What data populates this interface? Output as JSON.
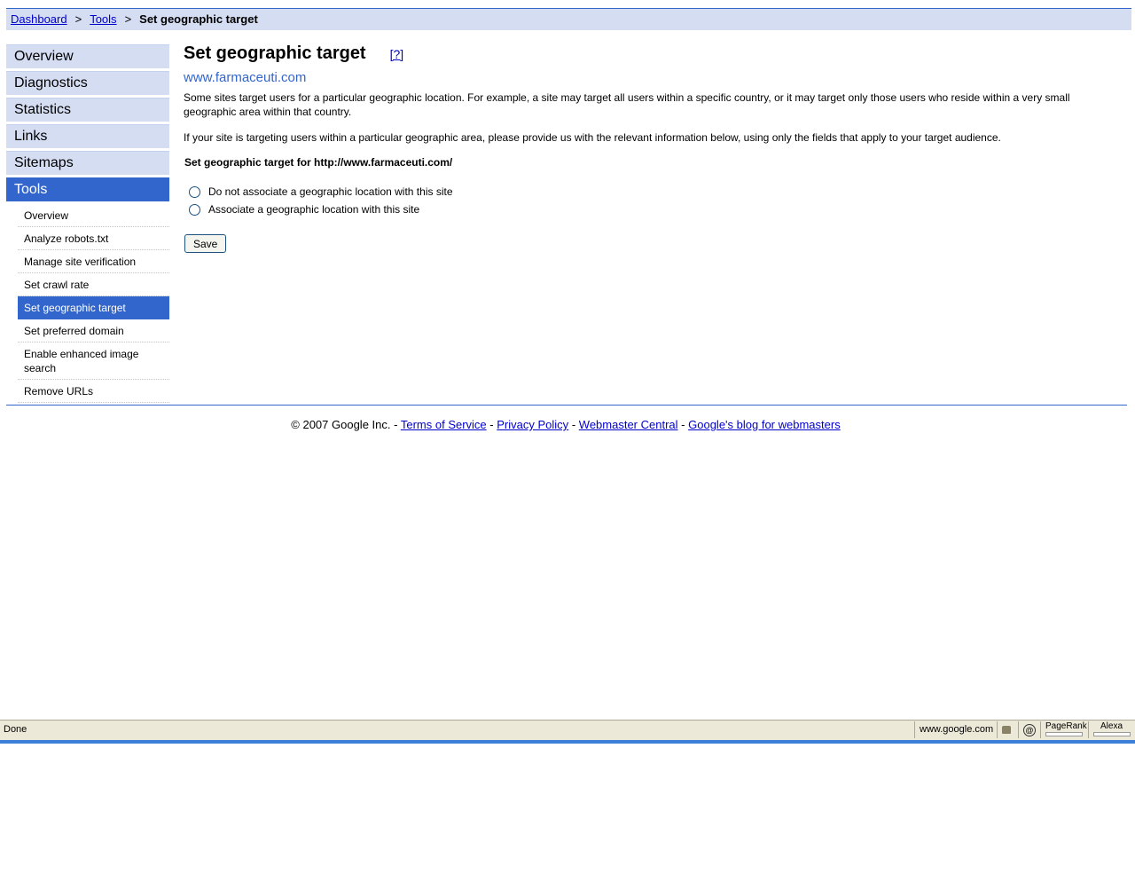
{
  "breadcrumb": {
    "items": [
      "Dashboard",
      "Tools"
    ],
    "separator": ">",
    "current": "Set geographic target"
  },
  "sidebar": {
    "items": [
      {
        "label": "Overview"
      },
      {
        "label": "Diagnostics"
      },
      {
        "label": "Statistics"
      },
      {
        "label": "Links"
      },
      {
        "label": "Sitemaps"
      },
      {
        "label": "Tools"
      }
    ],
    "subitems": [
      {
        "label": "Overview"
      },
      {
        "label": "Analyze robots.txt"
      },
      {
        "label": "Manage site verification"
      },
      {
        "label": "Set crawl rate"
      },
      {
        "label": "Set geographic target"
      },
      {
        "label": "Set preferred domain"
      },
      {
        "label": "Enable enhanced image search"
      },
      {
        "label": "Remove URLs"
      }
    ]
  },
  "main": {
    "title": "Set geographic target",
    "help_link": "[?]",
    "site": "www.farmaceuti.com",
    "para1": "Some sites target users for a particular geographic location. For example, a site may target all users within a specific country, or it may target only those users who reside within a very small geographic area within that country.",
    "para2": "If your site is targeting users within a particular geographic area, please provide us with the relevant information below, using only the fields that apply to your target audience.",
    "subhead": "Set geographic target for http://www.farmaceuti.com/",
    "options": [
      "Do not associate a geographic location with this site",
      "Associate a geographic location with this site"
    ],
    "save_label": "Save"
  },
  "footer": {
    "copyright": "© 2007 Google Inc.",
    "sep": "-",
    "links": [
      "Terms of Service",
      "Privacy Policy",
      "Webmaster Central",
      "Google's blog for webmasters"
    ]
  },
  "statusbar": {
    "status": "Done",
    "host": "www.google.com",
    "pagerank_label": "PageRank",
    "alexa_label": "Alexa",
    "icons": [
      "lock-icon",
      "at-icon"
    ]
  },
  "colors": {
    "accent": "#3366cc",
    "nav_bg": "#d5ddf3",
    "link": "#0000cc"
  }
}
